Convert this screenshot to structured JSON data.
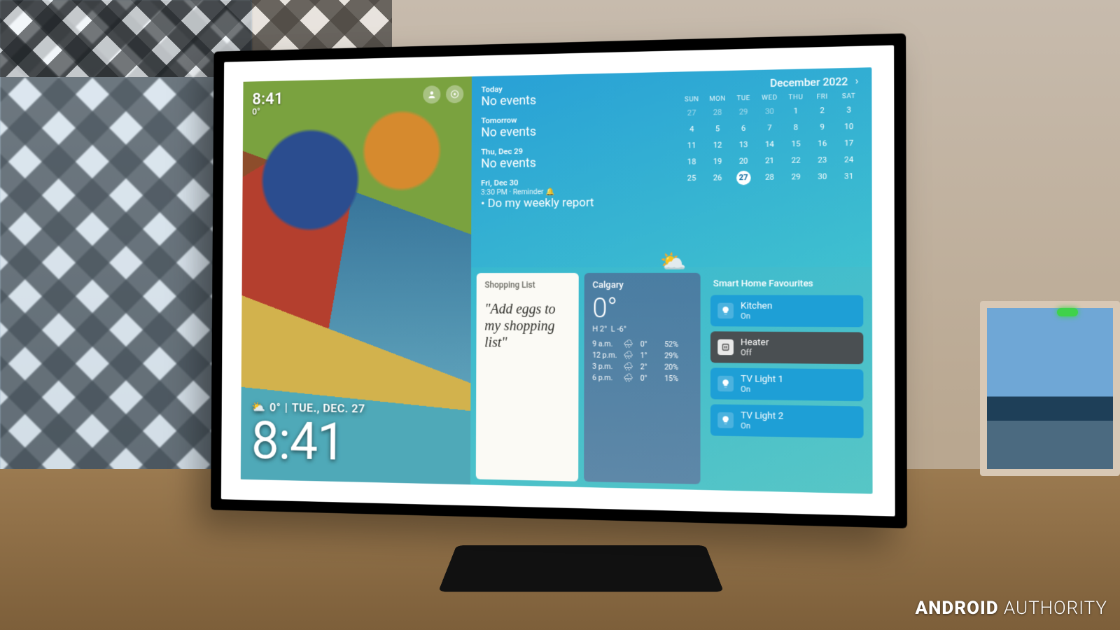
{
  "watermark": {
    "bold": "ANDROID",
    "light": " AUTHORITY"
  },
  "header_small": {
    "time": "8:41",
    "temp": "0°"
  },
  "header_icons": {
    "profile": "profile-icon",
    "assistant": "assistant-icon"
  },
  "dateline": {
    "temp": "0°",
    "sep": "|",
    "day": "TUE., DEC. 27"
  },
  "big_time": "8:41",
  "agenda": [
    {
      "label": "Today",
      "text": "No events"
    },
    {
      "label": "Tomorrow",
      "text": "No events"
    },
    {
      "label": "Thu, Dec 29",
      "text": "No events"
    }
  ],
  "reminder": {
    "day": "Fri, Dec 30",
    "time": "3:30 PM · Reminder",
    "text": "Do my weekly report"
  },
  "calendar": {
    "title": "December 2022",
    "dow": [
      "SUN",
      "MON",
      "TUE",
      "WED",
      "THU",
      "FRI",
      "SAT"
    ],
    "leading_dim": [
      "27",
      "28",
      "29",
      "30"
    ],
    "days": [
      "1",
      "2",
      "3",
      "4",
      "5",
      "6",
      "7",
      "8",
      "9",
      "10",
      "11",
      "12",
      "13",
      "14",
      "15",
      "16",
      "17",
      "18",
      "19",
      "20",
      "21",
      "22",
      "23",
      "24",
      "25",
      "26",
      "27",
      "28",
      "29",
      "30",
      "31"
    ],
    "today": "27"
  },
  "shopping": {
    "title": "Shopping List",
    "quote": "\"Add eggs to my shopping list\""
  },
  "weather": {
    "city": "Calgary",
    "temp": "0°",
    "hi": "H 2°",
    "lo": "L -6°",
    "forecast": [
      {
        "t": "9 a.m.",
        "temp": "0°",
        "hum": "52%"
      },
      {
        "t": "12 p.m.",
        "temp": "1°",
        "hum": "29%"
      },
      {
        "t": "3 p.m.",
        "temp": "2°",
        "hum": "20%"
      },
      {
        "t": "6 p.m.",
        "temp": "0°",
        "hum": "15%"
      }
    ]
  },
  "smart": {
    "title": "Smart Home Favourites",
    "devices": [
      {
        "name": "Kitchen",
        "state": "On",
        "on": true,
        "icon": "bulb-icon"
      },
      {
        "name": "Heater",
        "state": "Off",
        "on": false,
        "icon": "plug-icon"
      },
      {
        "name": "TV Light 1",
        "state": "On",
        "on": true,
        "icon": "bulb-icon"
      },
      {
        "name": "TV Light 2",
        "state": "On",
        "on": true,
        "icon": "bulb-icon"
      }
    ]
  }
}
